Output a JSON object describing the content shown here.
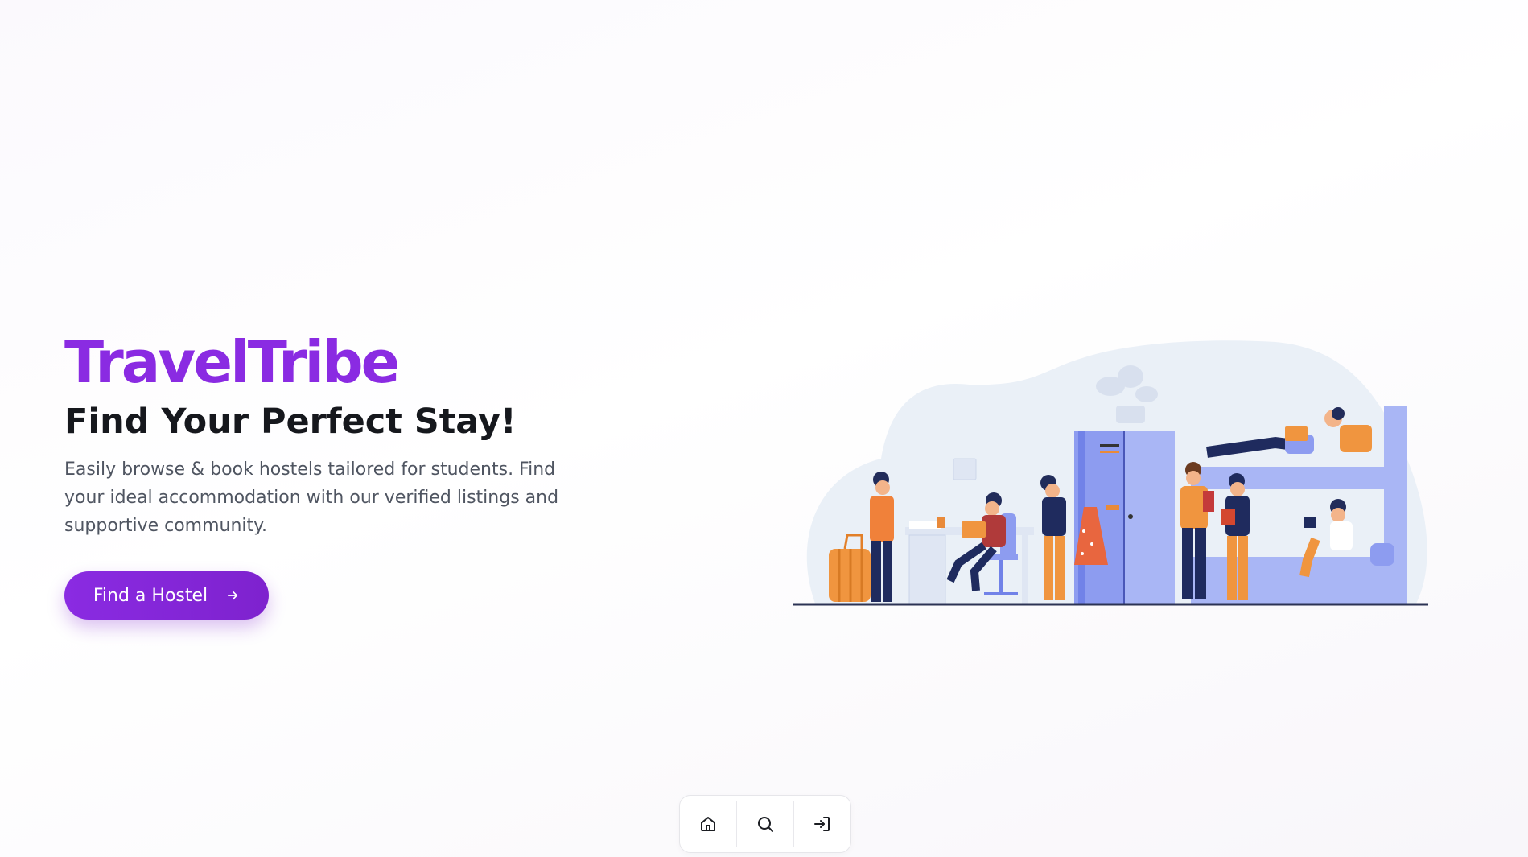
{
  "hero": {
    "brand": "TravelTribe",
    "headline": "Find Your Perfect Stay!",
    "description": "Easily browse & book hostels tailored for students. Find your ideal accommodation with our verified listings and supportive community.",
    "cta_label": "Find a Hostel",
    "cta_icon": "arrow-right-icon"
  },
  "illustration": {
    "name": "students-in-hostel-dorm-illustration"
  },
  "dock": {
    "items": [
      {
        "icon": "home-icon"
      },
      {
        "icon": "search-icon"
      },
      {
        "icon": "login-icon"
      }
    ]
  },
  "colors": {
    "accent": "#8a2be2",
    "headline": "#16181d",
    "body_text": "#4f5561"
  }
}
